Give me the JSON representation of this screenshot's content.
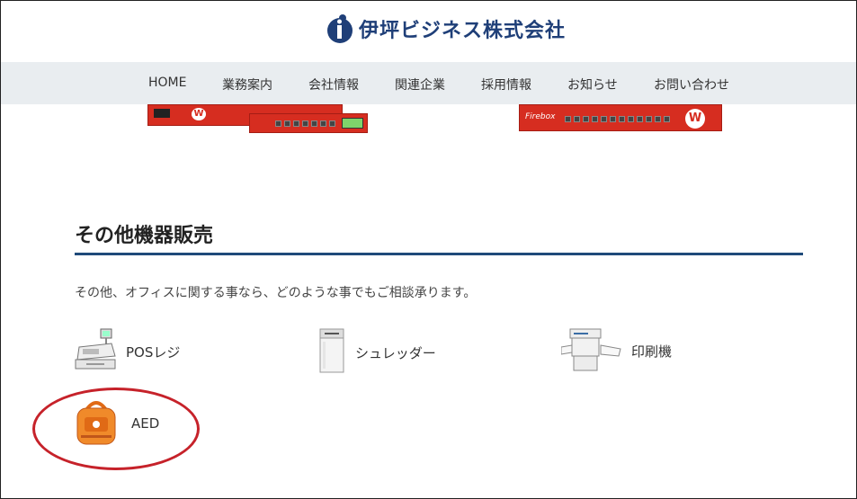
{
  "header": {
    "logo_text": "伊坪ビジネス株式会社",
    "logo_mark": "i"
  },
  "nav": {
    "items": [
      {
        "label": "HOME"
      },
      {
        "label": "業務案内"
      },
      {
        "label": "会社情報"
      },
      {
        "label": "関連企業"
      },
      {
        "label": "採用情報"
      },
      {
        "label": "お知らせ"
      },
      {
        "label": "お問い合わせ"
      }
    ]
  },
  "banner": {
    "left_device_text": "W",
    "right_device_brand": "Firebox"
  },
  "section": {
    "title": "その他機器販売",
    "description": "その他、オフィスに関する事なら、どのような事でもご相談承ります。"
  },
  "products": [
    {
      "label": "POSレジ",
      "icon": "cash-register-icon"
    },
    {
      "label": "シュレッダー",
      "icon": "shredder-icon"
    },
    {
      "label": "印刷機",
      "icon": "printer-icon"
    },
    {
      "label": "AED",
      "icon": "aed-icon"
    }
  ],
  "colors": {
    "brand": "#1f3f78",
    "nav_bg": "#e9edf0",
    "rule": "#1f4a7a",
    "highlight_circle": "#c6222a",
    "device_red": "#d62d20"
  }
}
